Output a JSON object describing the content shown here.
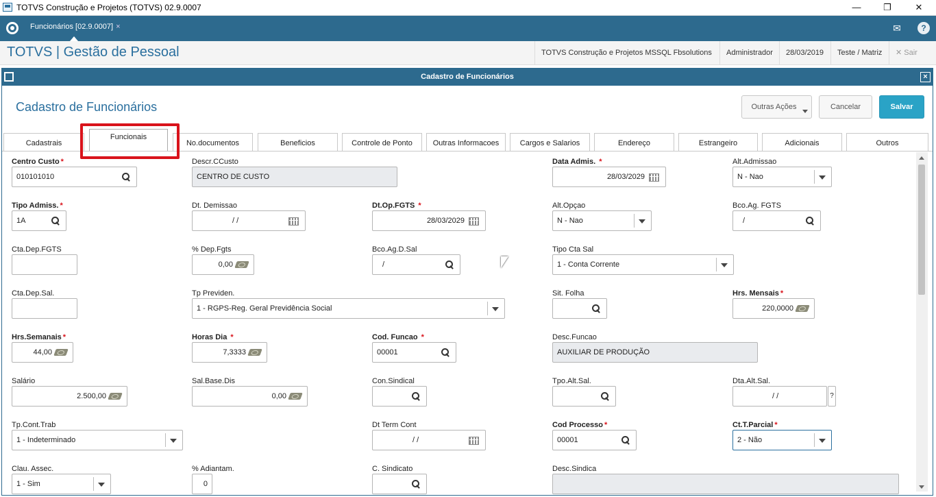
{
  "window": {
    "title": "TOTVS Construção e Projetos (TOTVS) 02.9.0007",
    "minimize": "—",
    "restore": "❐",
    "close": "✕"
  },
  "tabbar": {
    "active_tab": "Funcionários [02.9.0007]",
    "tab_close": "×",
    "mail_icon": "mail-icon",
    "help_label": "?"
  },
  "header": {
    "app_title": "TOTVS | Gestão de Pessoal",
    "company": "TOTVS Construção e Projetos MSSQL Fbsolutions",
    "user": "Administrador",
    "date": "28/03/2019",
    "branch": "Teste / Matriz",
    "exit_label": "Sair"
  },
  "dialog": {
    "title": "Cadastro de Funcionários",
    "close": "×",
    "form_title": "Cadastro de Funcionários",
    "buttons": {
      "other_actions": "Outras Ações",
      "cancel": "Cancelar",
      "save": "Salvar"
    }
  },
  "tabs": [
    {
      "label": "Cadastrais"
    },
    {
      "label": "Funcionais"
    },
    {
      "label": "No.documentos"
    },
    {
      "label": "Beneficios"
    },
    {
      "label": "Controle de Ponto"
    },
    {
      "label": "Outras Informacoes"
    },
    {
      "label": "Cargos e Salarios"
    },
    {
      "label": "Endereço"
    },
    {
      "label": "Estrangeiro"
    },
    {
      "label": "Adicionais"
    },
    {
      "label": "Outros"
    }
  ],
  "fields": {
    "centro_custo": {
      "label": "Centro Custo",
      "value": "010101010"
    },
    "descr_ccusto": {
      "label": "Descr.CCusto",
      "value": "CENTRO DE CUSTO"
    },
    "data_admis": {
      "label": "Data Admis. ",
      "value": "28/03/2029"
    },
    "alt_admissao": {
      "label": "Alt.Admissao",
      "value": "N - Nao"
    },
    "tipo_admiss": {
      "label": "Tipo Admiss.",
      "value": "1A"
    },
    "dt_demissao": {
      "label": "Dt. Demissao",
      "value": "/ /"
    },
    "dt_op_fgts": {
      "label": "Dt.Op.FGTS ",
      "value": "28/03/2029"
    },
    "alt_opcao": {
      "label": "Alt.Opçao",
      "value": "N - Nao"
    },
    "bco_ag_fgts": {
      "label": "Bco.Ag. FGTS",
      "value": "/"
    },
    "cta_dep_fgts": {
      "label": "Cta.Dep.FGTS",
      "value": ""
    },
    "pct_dep_fgts": {
      "label": "% Dep.Fgts",
      "value": "0,00"
    },
    "bco_ag_d_sal": {
      "label": "Bco.Ag.D.Sal",
      "value": "/"
    },
    "tipo_cta_sal": {
      "label": "Tipo Cta Sal",
      "value": "1 - Conta Corrente"
    },
    "cta_dep_sal": {
      "label": "Cta.Dep.Sal.",
      "value": ""
    },
    "tp_previden": {
      "label": "Tp Previden.",
      "value": "1 - RGPS-Reg. Geral Previdência Social"
    },
    "sit_folha": {
      "label": "Sit. Folha",
      "value": ""
    },
    "hrs_mensais": {
      "label": "Hrs. Mensais",
      "value": "220,0000"
    },
    "hrs_semanais": {
      "label": "Hrs.Semanais",
      "value": "44,00"
    },
    "horas_dia": {
      "label": "Horas Dia ",
      "value": "7,3333"
    },
    "cod_funcao": {
      "label": "Cod. Funcao ",
      "value": "00001"
    },
    "desc_funcao": {
      "label": "Desc.Funcao",
      "value": "AUXILIAR DE PRODUÇÃO"
    },
    "salario": {
      "label": "Salário",
      "value": "2.500,00"
    },
    "sal_base_dis": {
      "label": "Sal.Base.Dis",
      "value": "0,00"
    },
    "con_sindical": {
      "label": "Con.Sindical",
      "value": ""
    },
    "tpo_alt_sal": {
      "label": "Tpo.Alt.Sal.",
      "value": ""
    },
    "dta_alt_sal": {
      "label": "Dta.Alt.Sal.",
      "value": "/ /",
      "help": "?"
    },
    "tp_cont_trab": {
      "label": "Tp.Cont.Trab",
      "value": "1 - Indeterminado"
    },
    "dt_term_cont": {
      "label": "Dt Term Cont",
      "value": "/ /"
    },
    "cod_processo": {
      "label": "Cod Processo",
      "value": "00001"
    },
    "ct_t_parcial": {
      "label": "Ct.T.Parcial",
      "value": "2 - Não"
    },
    "clau_assec": {
      "label": "Clau. Assec.",
      "value": "1 - Sim"
    },
    "pct_adiantam": {
      "label": "% Adiantam.",
      "value": "0"
    },
    "c_sindicato": {
      "label": "C. Sindicato",
      "value": ""
    },
    "desc_sindica": {
      "label": "Desc.Sindica",
      "value": ""
    }
  },
  "required_mark": "*",
  "colors": {
    "brand": "#2d6a8e",
    "title_blue": "#2a6f9e",
    "save_button": "#2aa3c6",
    "required": "#d9131b",
    "highlight": "#d9131b"
  }
}
